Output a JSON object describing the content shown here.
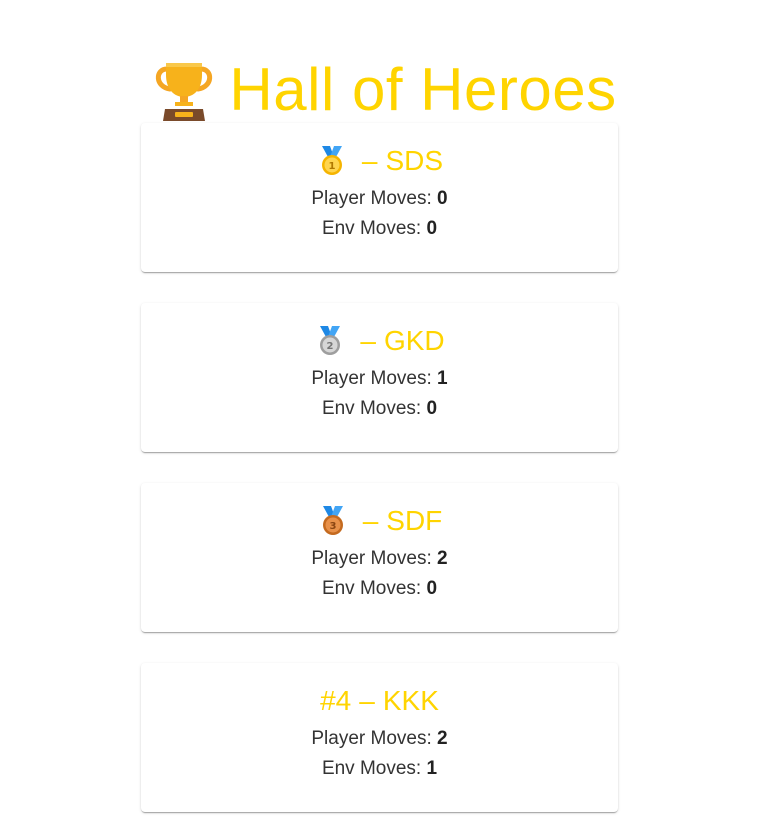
{
  "header": {
    "title": "Hall of Heroes",
    "icon": "trophy-icon",
    "color": "#FFD400"
  },
  "player_moves_label": "Player Moves:",
  "env_moves_label": "Env Moves:",
  "entries": [
    {
      "rank_label": "",
      "medal": "gold-medal-icon",
      "separator": "–",
      "name": "SDS",
      "player_moves": "0",
      "env_moves": "0"
    },
    {
      "rank_label": "",
      "medal": "silver-medal-icon",
      "separator": "–",
      "name": "GKD",
      "player_moves": "1",
      "env_moves": "0"
    },
    {
      "rank_label": "",
      "medal": "bronze-medal-icon",
      "separator": "–",
      "name": "SDF",
      "player_moves": "2",
      "env_moves": "0"
    },
    {
      "rank_label": "#4",
      "medal": "",
      "separator": "–",
      "name": "KKK",
      "player_moves": "2",
      "env_moves": "1"
    }
  ]
}
